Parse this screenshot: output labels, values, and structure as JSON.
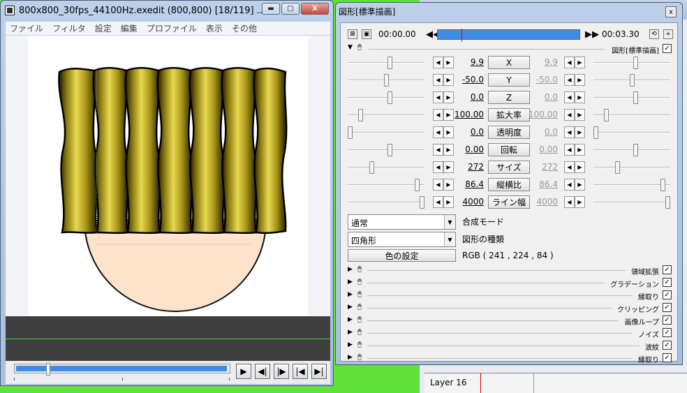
{
  "background_window": {
    "layer_label": "Layer 16"
  },
  "edit_window": {
    "title": "800x800_30fps_44100Hz.exedit (800,800)  [18/119]  ...",
    "controls": {
      "minimize": "▬",
      "maximize": "□",
      "close": "X"
    },
    "menu": [
      "ファイル",
      "フィルタ",
      "設定",
      "編集",
      "プロファイル",
      "表示",
      "その他"
    ],
    "playback": {
      "play": "▶",
      "prev": "◀|",
      "next": "|▶",
      "first": "|◀",
      "last": "▶|"
    },
    "seek_position": 0.15,
    "colors": {
      "seek_fill": "#3d8de8",
      "canvas_shape": "#fde3cc",
      "preview_bg": "#404040",
      "timeline_line": "#3cc83c"
    }
  },
  "settings_window": {
    "title": "図形[標準描画]",
    "close": "x",
    "time_start": "00:00.00",
    "time_end": "00:03.30",
    "section_label": "図形[標準描画]",
    "section_checked": true,
    "params": [
      {
        "name": "X",
        "left": "9.9",
        "right": "9.9",
        "slider_l": 0.55,
        "slider_r": 0.55
      },
      {
        "name": "Y",
        "left": "-50.0",
        "right": "-50.0",
        "slider_l": 0.5,
        "slider_r": 0.5
      },
      {
        "name": "Z",
        "left": "0.0",
        "right": "0.0",
        "slider_l": 0.55,
        "slider_r": 0.55
      },
      {
        "name": "拡大率",
        "left": "100.00",
        "right": "100.00",
        "slider_l": 0.15,
        "slider_r": 0.15
      },
      {
        "name": "透明度",
        "left": "0.0",
        "right": "0.0",
        "slider_l": 0.0,
        "slider_r": 0.0
      },
      {
        "name": "回転",
        "left": "0.00",
        "right": "0.00",
        "slider_l": 0.55,
        "slider_r": 0.55
      },
      {
        "name": "サイズ",
        "left": "272",
        "right": "272",
        "slider_l": 0.3,
        "slider_r": 0.3
      },
      {
        "name": "縦横比",
        "left": "86.4",
        "right": "86.4",
        "slider_l": 0.93,
        "slider_r": 0.93
      },
      {
        "name": "ライン幅",
        "left": "4000",
        "right": "4000",
        "slider_l": 1.0,
        "slider_r": 1.0
      }
    ],
    "blend_mode": {
      "value": "通常",
      "label": "合成モード"
    },
    "shape_type": {
      "value": "四角形",
      "label": "図形の種類"
    },
    "color_button": "色の設定",
    "rgb_text": "RGB ( 241 , 224 , 84 )",
    "filters": [
      {
        "label": "領域拡張",
        "checked": true
      },
      {
        "label": "グラデーション",
        "checked": true
      },
      {
        "label": "縁取り",
        "checked": true
      },
      {
        "label": "クリッピング",
        "checked": true
      },
      {
        "label": "画像ループ",
        "checked": true
      },
      {
        "label": "ノイズ",
        "checked": true
      },
      {
        "label": "波紋",
        "checked": true
      },
      {
        "label": "縁取り",
        "checked": true
      }
    ],
    "colors": {
      "timeline_bar": "#3d8de8",
      "cursor": "#dd0000"
    }
  }
}
